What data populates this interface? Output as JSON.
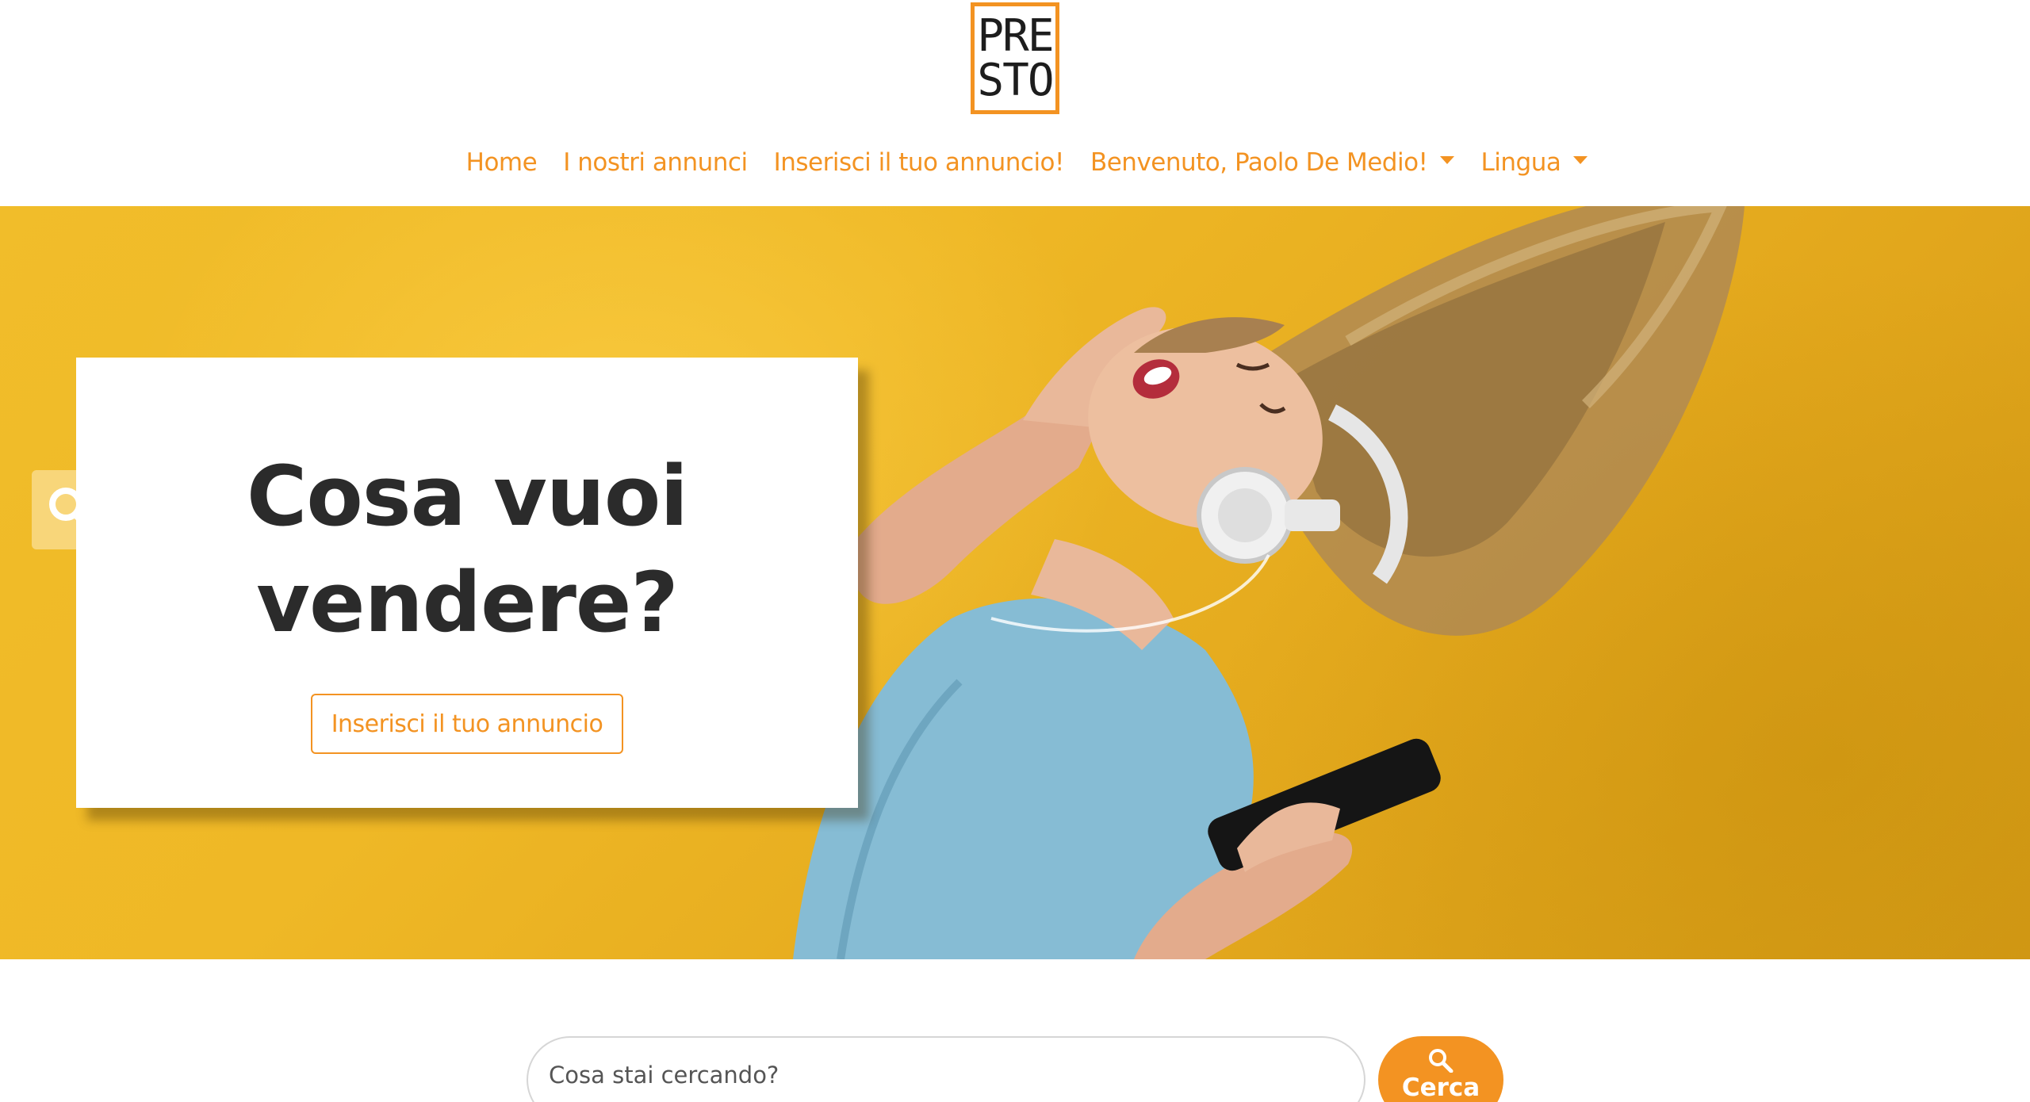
{
  "brand": {
    "logo_line1": "PRE",
    "logo_line2": "STO"
  },
  "nav": {
    "home": "Home",
    "ads": "I nostri annunci",
    "insert": "Inserisci il tuo annuncio!",
    "user": "Benvenuto, Paolo De Medio!",
    "language": "Lingua"
  },
  "hero": {
    "title": "Cosa vuoi vendere?",
    "cta": "Inserisci il tuo annuncio"
  },
  "search": {
    "placeholder": "Cosa stai cercando?",
    "button": "Cerca"
  },
  "colors": {
    "accent": "#f39322",
    "hero_bg": "#efb826",
    "title": "#2b2b2b"
  },
  "icons": [
    "search-icon",
    "caret-down-icon"
  ]
}
